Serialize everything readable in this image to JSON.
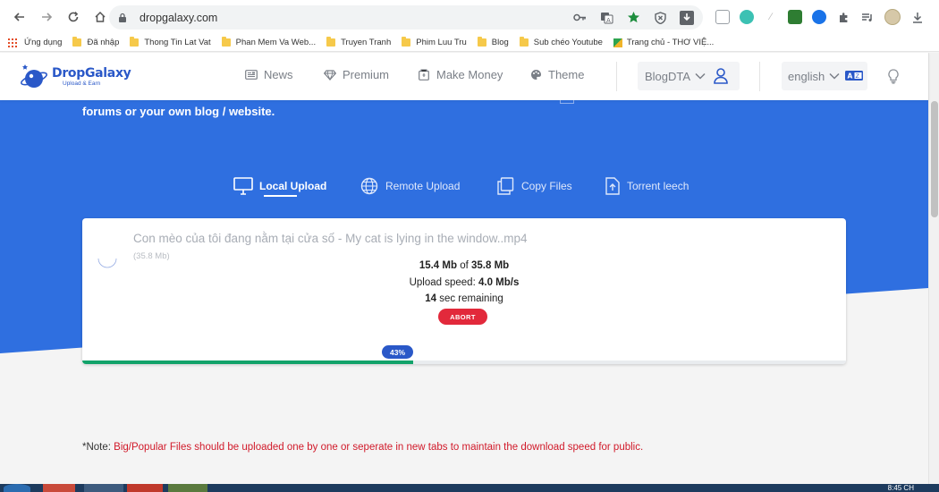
{
  "browser": {
    "url": "dropgalaxy.com",
    "bookmarks": [
      {
        "label": "Ứng dụng",
        "icon": "apps-grid-icon"
      },
      {
        "label": "Đã nhập",
        "icon": "folder-icon"
      },
      {
        "label": "Thong Tin Lat Vat",
        "icon": "folder-icon"
      },
      {
        "label": "Phan Mem Va Web...",
        "icon": "folder-icon"
      },
      {
        "label": "Truyen Tranh",
        "icon": "folder-icon"
      },
      {
        "label": "Phim Luu Tru",
        "icon": "folder-icon"
      },
      {
        "label": "Blog",
        "icon": "folder-icon"
      },
      {
        "label": "Sub chéo Youtube",
        "icon": "folder-icon"
      },
      {
        "label": "Trang chủ - THƠ VIỆ...",
        "icon": "page-icon"
      }
    ]
  },
  "header": {
    "logo_title": "DropGalaxy",
    "logo_tagline": "Upload & Earn",
    "menu": [
      {
        "label": "News",
        "icon": "newspaper-icon"
      },
      {
        "label": "Premium",
        "icon": "diamond-icon"
      },
      {
        "label": "Make Money",
        "icon": "wallet-icon"
      },
      {
        "label": "Theme",
        "icon": "palette-icon"
      }
    ],
    "blog_select": "BlogDTA",
    "language_select": "english"
  },
  "hero": {
    "text": "forums or your own blog / website.",
    "tabs": [
      {
        "label": "Local Upload",
        "icon": "monitor-icon",
        "active": true
      },
      {
        "label": "Remote Upload",
        "icon": "globe-icon",
        "active": false
      },
      {
        "label": "Copy Files",
        "icon": "copy-icon",
        "active": false
      },
      {
        "label": "Torrent leech",
        "icon": "torrent-file-icon",
        "active": false
      }
    ]
  },
  "upload": {
    "file_name": "Con mèo của tôi đang nằm tại cửa số - My cat is lying in the window..mp4",
    "file_size": "(35.8 Mb)",
    "uploaded": "15.4 Mb",
    "of_text": "of",
    "total": "35.8 Mb",
    "speed_label": "Upload speed:",
    "speed_value": "4.0 Mb/s",
    "remaining_value": "14",
    "remaining_label": "sec remaining",
    "abort_label": "ABORT",
    "progress_percent": 43,
    "progress_label": "43%"
  },
  "note": {
    "prefix": "*Note:",
    "text": "Big/Popular Files should be uploaded one by one or seperate in new tabs to maintain the download speed for public."
  },
  "taskbar": {
    "clock": "8:45 CH"
  },
  "colors": {
    "hero_blue": "#2f6fe0",
    "brand_blue": "#2a58c8",
    "abort_red": "#e2293b",
    "progress_green": "#12a36a",
    "note_red": "#d11a2a"
  }
}
